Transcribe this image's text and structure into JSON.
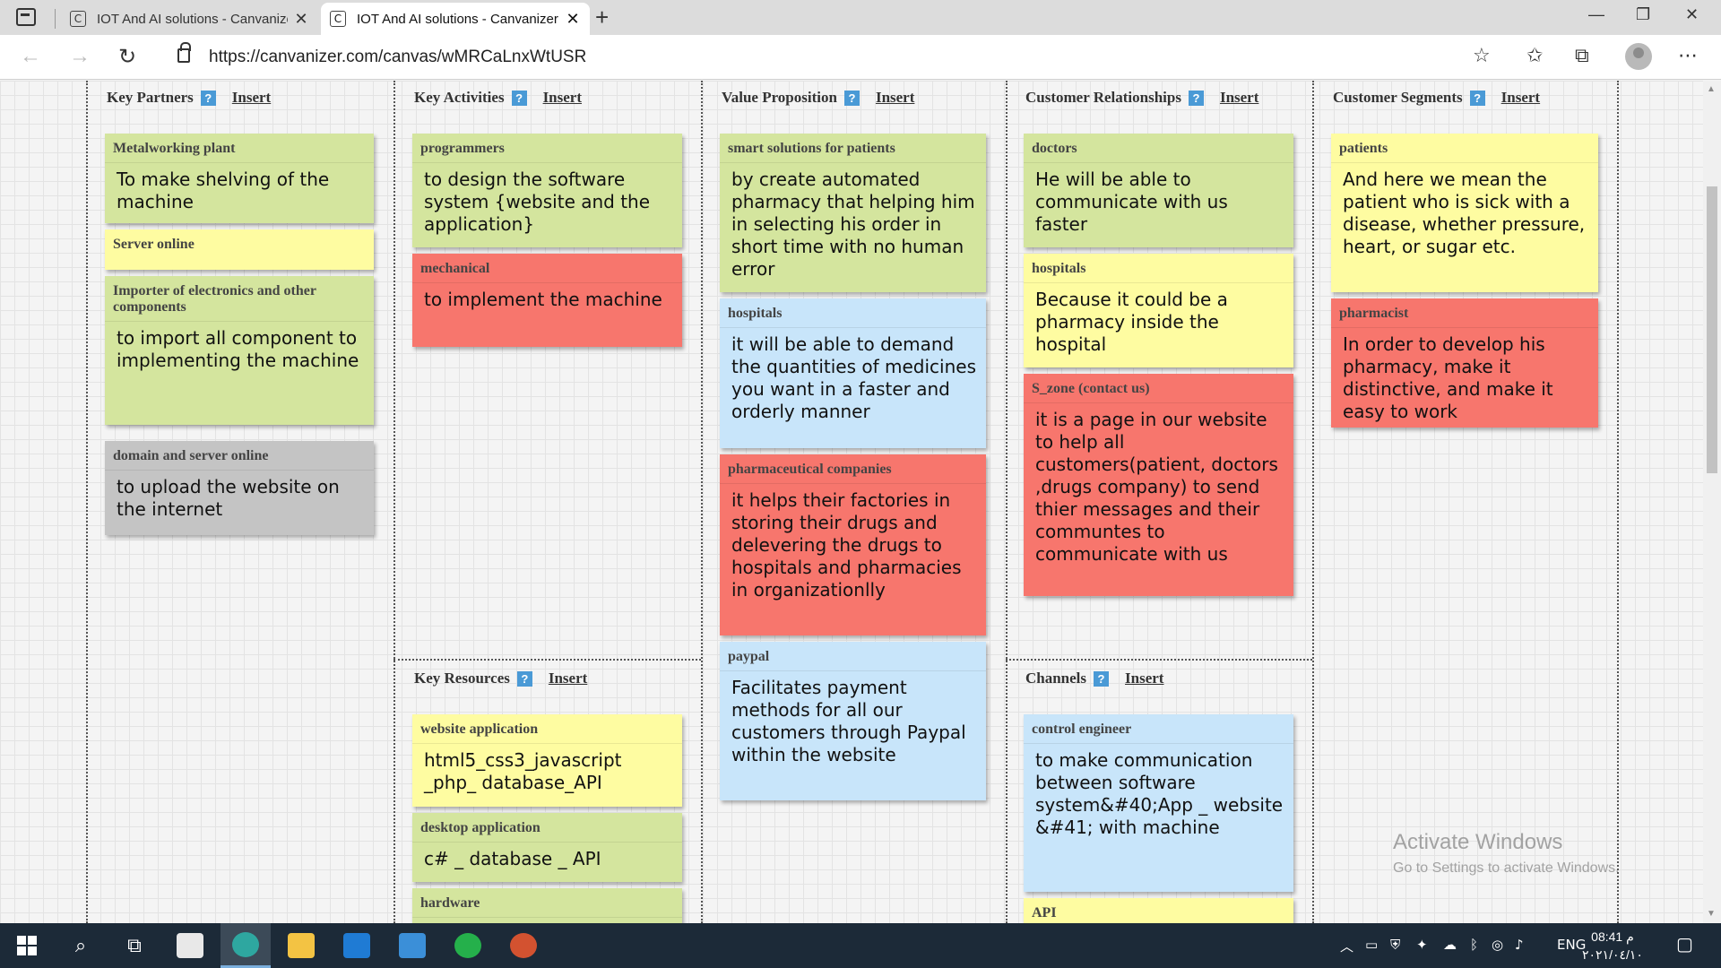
{
  "browser": {
    "tabs": [
      {
        "title": "IOT And AI solutions - Canvanizer",
        "favicon": "C",
        "active": false
      },
      {
        "title": "IOT And AI solutions - Canvanizer",
        "favicon": "C",
        "active": true
      }
    ],
    "url": "https://canvanizer.com/canvas/wMRCaLnxWtUSR"
  },
  "canvas": {
    "insert_label": "Insert",
    "help_label": "?",
    "sections": {
      "key_partners": {
        "title": "Key Partners",
        "notes": [
          {
            "title": "Metalworking plant",
            "body": "To make shelving of the machine",
            "color": "#d4e59e"
          },
          {
            "title": "Server online",
            "body": "",
            "color": "#fefca1"
          },
          {
            "title": "Importer of electronics and other components",
            "body": "to import all component to implementing the machine",
            "color": "#d4e59e"
          },
          {
            "title": "domain and server online",
            "body": "to upload the website on the internet",
            "color": "#c4c4c4"
          }
        ]
      },
      "key_activities": {
        "title": "Key Activities",
        "notes": [
          {
            "title": "programmers",
            "body": "to design the software system {website and the application}",
            "color": "#d4e59e"
          },
          {
            "title": "mechanical",
            "body": "to implement the machine",
            "color": "#f7766d"
          }
        ]
      },
      "key_resources": {
        "title": "Key Resources",
        "notes": [
          {
            "title": "website application",
            "body": "html5_css3_javascript _php_ database_API",
            "color": "#fefca1"
          },
          {
            "title": "desktop application",
            "body": "c# _ database _ API",
            "color": "#d4e59e"
          },
          {
            "title": "hardware",
            "body": "",
            "color": "#d4e59e"
          }
        ]
      },
      "value_proposition": {
        "title": "Value Proposition",
        "notes": [
          {
            "title": "smart solutions for patients",
            "body": "by create automated pharmacy that helping him in selecting his order in short time with no human error",
            "color": "#d4e59e"
          },
          {
            "title": "hospitals",
            "body": "it will be able to demand the quantities of medicines you want in a faster and orderly manner",
            "color": "#c8e5fa"
          },
          {
            "title": "pharmaceutical companies",
            "body": "it helps their factories in storing their drugs and delevering the drugs to hospitals and pharmacies in organizationlly",
            "color": "#f7766d"
          },
          {
            "title": "paypal",
            "body": "Facilitates payment methods for all our customers through Paypal within the website",
            "color": "#c8e5fa"
          }
        ]
      },
      "customer_relationships": {
        "title": "Customer Relationships",
        "notes": [
          {
            "title": "doctors",
            "body": "He will be able to communicate with us faster",
            "color": "#d4e59e"
          },
          {
            "title": "hospitals",
            "body": "Because it could be a pharmacy inside the hospital",
            "color": "#fefca1"
          },
          {
            "title": "S_zone (contact us)",
            "body": "it is a page in our website to help all customers(patient, doctors ,drugs company) to send thier messages and their communtes to communicate with us",
            "color": "#f7766d"
          }
        ]
      },
      "channels": {
        "title": "Channels",
        "notes": [
          {
            "title": "control engineer",
            "body": "to make communication between software system&#40;App _ website &#41; with machine",
            "color": "#c8e5fa"
          },
          {
            "title": "API",
            "body": "",
            "color": "#fefca1"
          }
        ]
      },
      "customer_segments": {
        "title": "Customer Segments",
        "notes": [
          {
            "title": "patients",
            "body": "And here we mean the patient who is sick with a disease, whether pressure, heart, or sugar etc.",
            "color": "#fefca1"
          },
          {
            "title": "pharmacist",
            "body": "In order to develop his pharmacy, make it distinctive, and make it easy to work",
            "color": "#f7766d"
          }
        ]
      }
    }
  },
  "watermark": {
    "line1": "Activate Windows",
    "line2": "Go to Settings to activate Windows."
  },
  "taskbar": {
    "language": "ENG",
    "time": "08:41 م",
    "date": "٢٠٢١/٠٤/١٠"
  }
}
